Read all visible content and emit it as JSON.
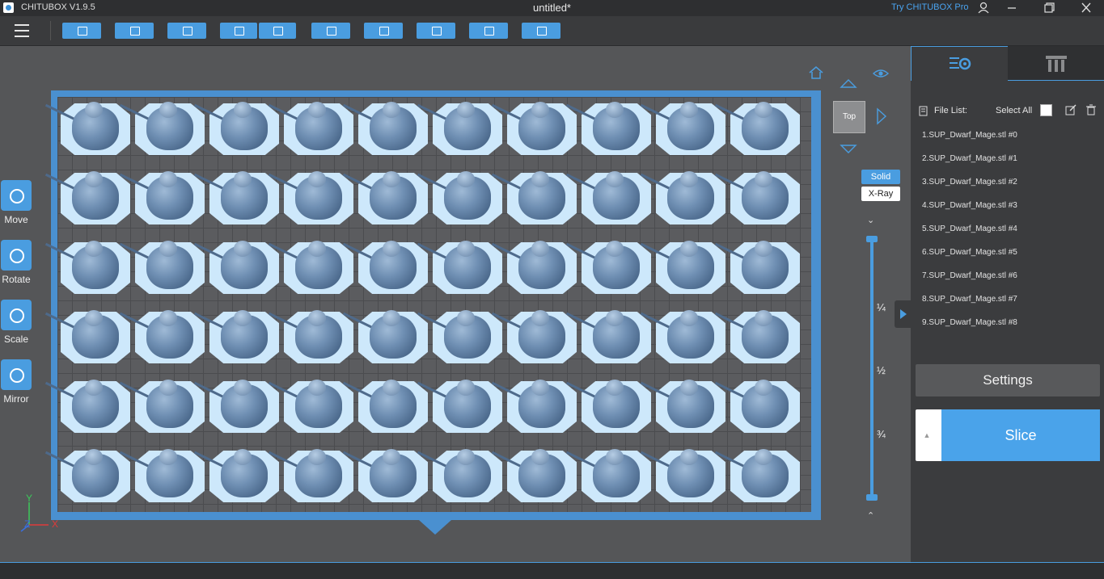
{
  "window": {
    "app_title": "CHITUBOX V1.9.5",
    "document_title": "untitled*",
    "pro_link": "Try CHITUBOX Pro"
  },
  "toolbar": {
    "buttons": [
      "open-file-icon",
      "save-icon",
      "auto-layout-icon",
      "undo-icon",
      "redo-icon",
      "duplicate-icon",
      "arrange-icon",
      "supports-icon",
      "hollow-icon",
      "print-icon"
    ]
  },
  "left_tools": {
    "move": "Move",
    "rotate": "Rotate",
    "scale": "Scale",
    "mirror": "Mirror"
  },
  "axes": {
    "y": "Y",
    "z": "Z",
    "x": "X"
  },
  "view": {
    "cube_label": "Top",
    "solid": "Solid",
    "xray": "X-Ray",
    "fractions": [
      "¼",
      "½",
      "¾"
    ]
  },
  "accent_color": "#4a9de0",
  "file_list": {
    "label": "File List:",
    "select_all": "Select All",
    "items": [
      "1.SUP_Dwarf_Mage.stl #0",
      "2.SUP_Dwarf_Mage.stl #1",
      "3.SUP_Dwarf_Mage.stl #2",
      "4.SUP_Dwarf_Mage.stl #3",
      "5.SUP_Dwarf_Mage.stl #4",
      "6.SUP_Dwarf_Mage.stl #5",
      "7.SUP_Dwarf_Mage.stl #6",
      "8.SUP_Dwarf_Mage.stl #7",
      "9.SUP_Dwarf_Mage.stl #8"
    ]
  },
  "actions": {
    "settings": "Settings",
    "slice": "Slice"
  }
}
